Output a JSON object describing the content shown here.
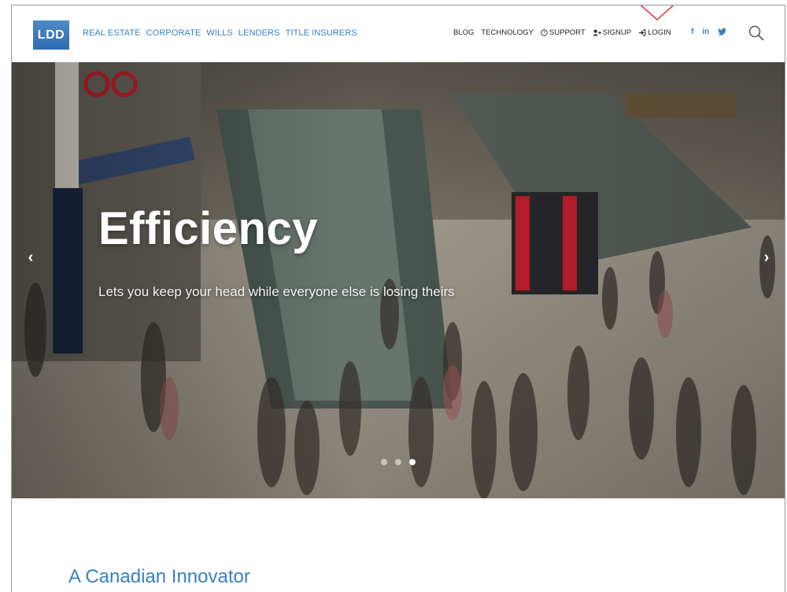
{
  "brand": {
    "logo_text": "LDD"
  },
  "nav": {
    "primary": [
      {
        "label": "REAL ESTATE"
      },
      {
        "label": "CORPORATE"
      },
      {
        "label": "WILLS"
      },
      {
        "label": "LENDERS"
      },
      {
        "label": "TITLE INSURERS"
      }
    ],
    "secondary": [
      {
        "label": "BLOG",
        "icon": ""
      },
      {
        "label": "TECHNOLOGY",
        "icon": ""
      },
      {
        "label": "SUPPORT",
        "icon": "question-circle-icon"
      },
      {
        "label": "SIGNUP",
        "icon": "user-plus-icon"
      },
      {
        "label": "LOGIN",
        "icon": "login-icon"
      }
    ],
    "social": [
      {
        "label": "f",
        "icon": "facebook-icon"
      },
      {
        "label": "in",
        "icon": "linkedin-icon"
      },
      {
        "label": "•",
        "icon": "twitter-icon"
      }
    ]
  },
  "hero": {
    "title": "Efficiency",
    "subtitle": "Lets you keep your head while everyone else is losing theirs",
    "prev_label": "‹",
    "next_label": "›",
    "slides_total": 3,
    "active_slide": 3
  },
  "section": {
    "title": "A Canadian Innovator"
  },
  "colors": {
    "accent": "#3a7fc4",
    "highlight_triangle": "#d9434e"
  }
}
